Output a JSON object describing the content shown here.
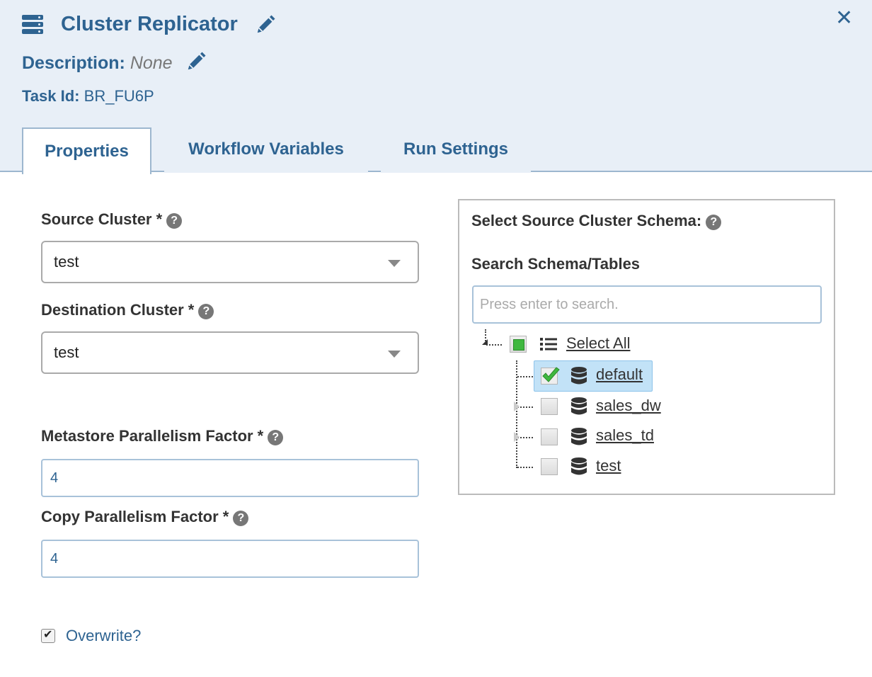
{
  "header": {
    "title": "Cluster Replicator",
    "description_label": "Description:",
    "description_value": "None",
    "task_id_label": "Task Id:",
    "task_id_value": "BR_FU6P",
    "close_glyph": "✕"
  },
  "tabs": [
    {
      "label": "Properties",
      "active": true
    },
    {
      "label": "Workflow Variables",
      "active": false
    },
    {
      "label": "Run Settings",
      "active": false
    }
  ],
  "form": {
    "source_cluster_label": "Source Cluster *",
    "source_cluster_value": "test",
    "destination_cluster_label": "Destination Cluster *",
    "destination_cluster_value": "test",
    "metastore_label": "Metastore Parallelism Factor *",
    "metastore_value": "4",
    "copy_label": "Copy Parallelism Factor *",
    "copy_value": "4",
    "overwrite_label": "Overwrite?",
    "overwrite_checked": true,
    "help_glyph": "?"
  },
  "schema_panel": {
    "title": "Select Source Cluster Schema:",
    "search_label": "Search Schema/Tables",
    "search_placeholder": "Press enter to search.",
    "tree": {
      "root_label": "Select All",
      "root_state": "partial",
      "nodes": [
        {
          "label": "default",
          "checked": true,
          "selected": true
        },
        {
          "label": "sales_dw",
          "checked": false,
          "selected": false
        },
        {
          "label": "sales_td",
          "checked": false,
          "selected": false
        },
        {
          "label": "test",
          "checked": false,
          "selected": false
        }
      ]
    }
  },
  "colors": {
    "accent": "#2e6391",
    "header_bg": "#e8eff7",
    "selected_bg": "#c2e2f7",
    "check_green": "#3fb83f"
  }
}
